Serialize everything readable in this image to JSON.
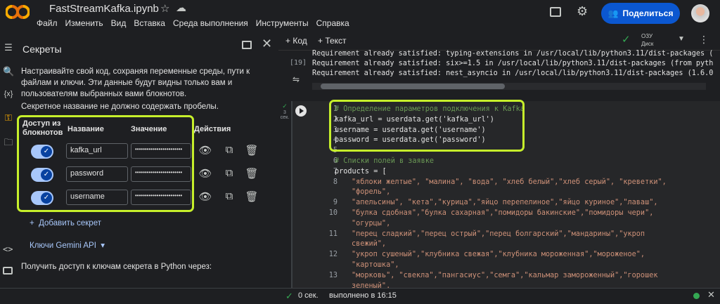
{
  "app": {
    "notebook_title": "FastStreamKafka.ipynb",
    "menu": [
      "Файл",
      "Изменить",
      "Вид",
      "Вставка",
      "Среда выполнения",
      "Инструменты",
      "Справка"
    ],
    "share_label": "Поделиться"
  },
  "colors": {
    "accent": "#0b57d0",
    "highlight": "#c6ef2b",
    "toggle": "#a8c7fa"
  },
  "secrets": {
    "title": "Секреты",
    "description": "Настраивайте свой код, сохраняя переменные среды, пути к файлам и ключи. Эти данные будут видны только вам и пользователям выбранных вами блокнотов.",
    "warning": "Секретное название не должно содержать пробелы.",
    "headers": {
      "access": "Доступ из блокнотов",
      "name": "Название",
      "value": "Значение",
      "actions": "Действия"
    },
    "rows": [
      {
        "name": "kafka_url",
        "value": "••••••••••••••••••••••••",
        "enabled": true
      },
      {
        "name": "password",
        "value": "••••••••••••••••••••••••",
        "enabled": true
      },
      {
        "name": "username",
        "value": "••••••••••••••••••••••••",
        "enabled": true
      }
    ],
    "add_label": "Добавить секрет",
    "gemini_label": "Ключи Gemini API",
    "access_text": "Получить доступ к ключам секрета в Python через:"
  },
  "toolbar": {
    "code_label": "Код",
    "text_label": "Текст",
    "ram_label": "ОЗУ",
    "disk_label": "Диск"
  },
  "output": {
    "exec_count": "[19]",
    "lines": [
      "Requirement already satisfied: typing-extensions in /usr/local/lib/python3.11/dist-packages (fr",
      "Requirement already satisfied: six>=1.5 in /usr/local/lib/python3.11/dist-packages (from python",
      "Requirement already satisfied: nest_asyncio in /usr/local/lib/python3.11/dist-packages (1.6.0)"
    ]
  },
  "cell": {
    "meta": "3 сек.",
    "lines": [
      {
        "n": "1",
        "t": "# Определение параметров подключения к Kafka",
        "k": "comment"
      },
      {
        "n": "2",
        "t": "kafka_url = userdata.get('kafka_url')",
        "k": "plain"
      },
      {
        "n": "3",
        "t": "username = userdata.get('username')",
        "k": "plain"
      },
      {
        "n": "4",
        "t": "password = userdata.get('password')",
        "k": "plain"
      },
      {
        "n": "5",
        "t": "",
        "k": "plain"
      },
      {
        "n": "6",
        "t": "# Списки полей в заявке",
        "k": "comment"
      },
      {
        "n": "7",
        "t": "products = [",
        "k": "plain"
      },
      {
        "n": "8",
        "t": "\"яблоки желтые\", \"малина\", \"вода\", \"хлеб белый\",\"хлеб серый\", \"креветки\",",
        "k": "str"
      },
      {
        "n": "",
        "t": "\"форель\",",
        "k": "str"
      },
      {
        "n": "9",
        "t": "\"апельсины\", \"кета\",\"курица\",\"яйцо перепелиное\",\"яйцо куриное\",\"лаваш\",",
        "k": "str"
      },
      {
        "n": "10",
        "t": "\"булка сдобная\",\"булка сахарная\",\"помидоры бакинские\",\"помидоры чери\",",
        "k": "str"
      },
      {
        "n": "",
        "t": "\"огурцы\",",
        "k": "str"
      },
      {
        "n": "11",
        "t": "\"перец сладкий\",\"перец острый\",\"перец болгарский\",\"мандарины\",\"укроп",
        "k": "str"
      },
      {
        "n": "",
        "t": "свежий\",",
        "k": "str"
      },
      {
        "n": "12",
        "t": "\"укроп сушеный\",\"клубника свежая\",\"клубника мороженная\",\"мороженое\",",
        "k": "str"
      },
      {
        "n": "",
        "t": "\"картошка\",",
        "k": "str"
      },
      {
        "n": "13",
        "t": "\"морковь\", \"свекла\",\"пангасиус\",\"семга\",\"кальмар замороженный\",\"горошек",
        "k": "str"
      },
      {
        "n": "",
        "t": "зеленый\",",
        "k": "str"
      }
    ]
  },
  "status": {
    "elapsed": "0 сек.",
    "done": "выполнено в 16:15"
  }
}
